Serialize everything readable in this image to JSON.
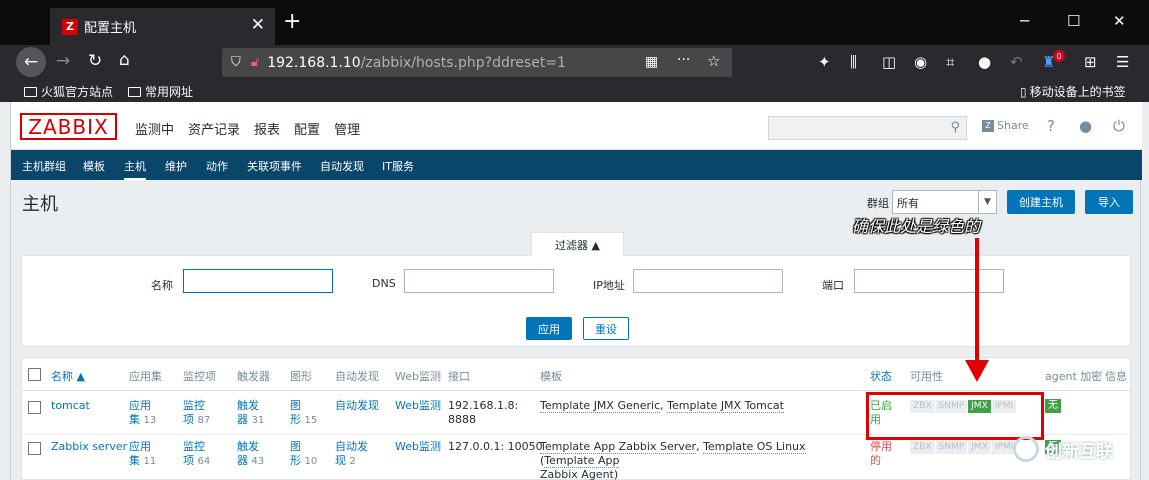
{
  "browser": {
    "tab_title": "配置主机",
    "favicon_letter": "Z",
    "url_host": "192.168.1.10",
    "url_path": "/zabbix/hosts.php?ddreset=1",
    "notification_count": "0",
    "bookmarks": [
      "火狐官方站点",
      "常用网址"
    ],
    "mobile_bookmarks": "移动设备上的书签"
  },
  "zabbix": {
    "logo": "ZABBIX",
    "main_menu": [
      "监测中",
      "资产记录",
      "报表",
      "配置",
      "管理"
    ],
    "share_label": "Share",
    "sub_menu": [
      "主机群组",
      "模板",
      "主机",
      "维护",
      "动作",
      "关联项事件",
      "自动发现",
      "IT服务"
    ],
    "page_title": "主机",
    "group_label": "群组",
    "group_value": "所有",
    "create_host_label": "创建主机",
    "import_label": "导入"
  },
  "filter": {
    "tab_label": "过滤器 ▲",
    "name_label": "名称",
    "dns_label": "DNS",
    "ip_label": "IP地址",
    "port_label": "端口",
    "apply_label": "应用",
    "reset_label": "重设"
  },
  "annotation": "确保此处是绿色的",
  "table": {
    "headers": [
      "名称 ▲",
      "应用集",
      "监控项",
      "触发器",
      "图形",
      "自动发现",
      "Web监测",
      "接口",
      "模板",
      "状态",
      "可用性",
      "agent 加密",
      "信息"
    ],
    "rows": [
      {
        "name": "tomcat",
        "apps_a": "应用",
        "apps_b": "集",
        "apps_count": "13",
        "items_a": "监控",
        "items_b": "项",
        "items_count": "87",
        "triggers_a": "触发",
        "triggers_b": "器",
        "triggers_count": "31",
        "graphs_a": "图",
        "graphs_b": "形",
        "graphs_count": "15",
        "discovery_a": "自动发现",
        "discovery_b": "",
        "discovery_count": "",
        "web": "Web监测",
        "interface_a": "192.168.1.8:",
        "interface_b": "8888",
        "template_1": "Template JMX Generic",
        "template_2": "Template JMX Tomcat",
        "status_a": "已启",
        "status_b": "用",
        "availability": [
          "ZBX",
          "SNMP",
          "JMX",
          "IPMI"
        ],
        "encryption": "无"
      },
      {
        "name": "Zabbix server",
        "apps_a": "应用",
        "apps_b": "集",
        "apps_count": "11",
        "items_a": "监控",
        "items_b": "项",
        "items_count": "64",
        "triggers_a": "触发",
        "triggers_b": "器",
        "triggers_count": "43",
        "graphs_a": "图",
        "graphs_b": "形",
        "graphs_count": "10",
        "discovery_a": "自动发",
        "discovery_b": "现",
        "discovery_count": "2",
        "web": "Web监测",
        "interface_a": "127.0.0.1: 10050",
        "template_1": "Template App Zabbix Server",
        "template_2": "Template OS Linux",
        "template_3": "Template App",
        "template_4": "Zabbix Agent",
        "status_a": "停用",
        "status_b": "的",
        "availability": [
          "ZBX",
          "SNMP",
          "JMX",
          "IPMI"
        ],
        "encryption": "无"
      }
    ]
  },
  "watermark": "创新互联",
  "colors": {
    "zabbix_red": "#d40000",
    "submenu_bg": "#0a466a",
    "button_blue": "#0275b8",
    "ok_green": "#429e47",
    "annotation_red": "#e00000"
  }
}
